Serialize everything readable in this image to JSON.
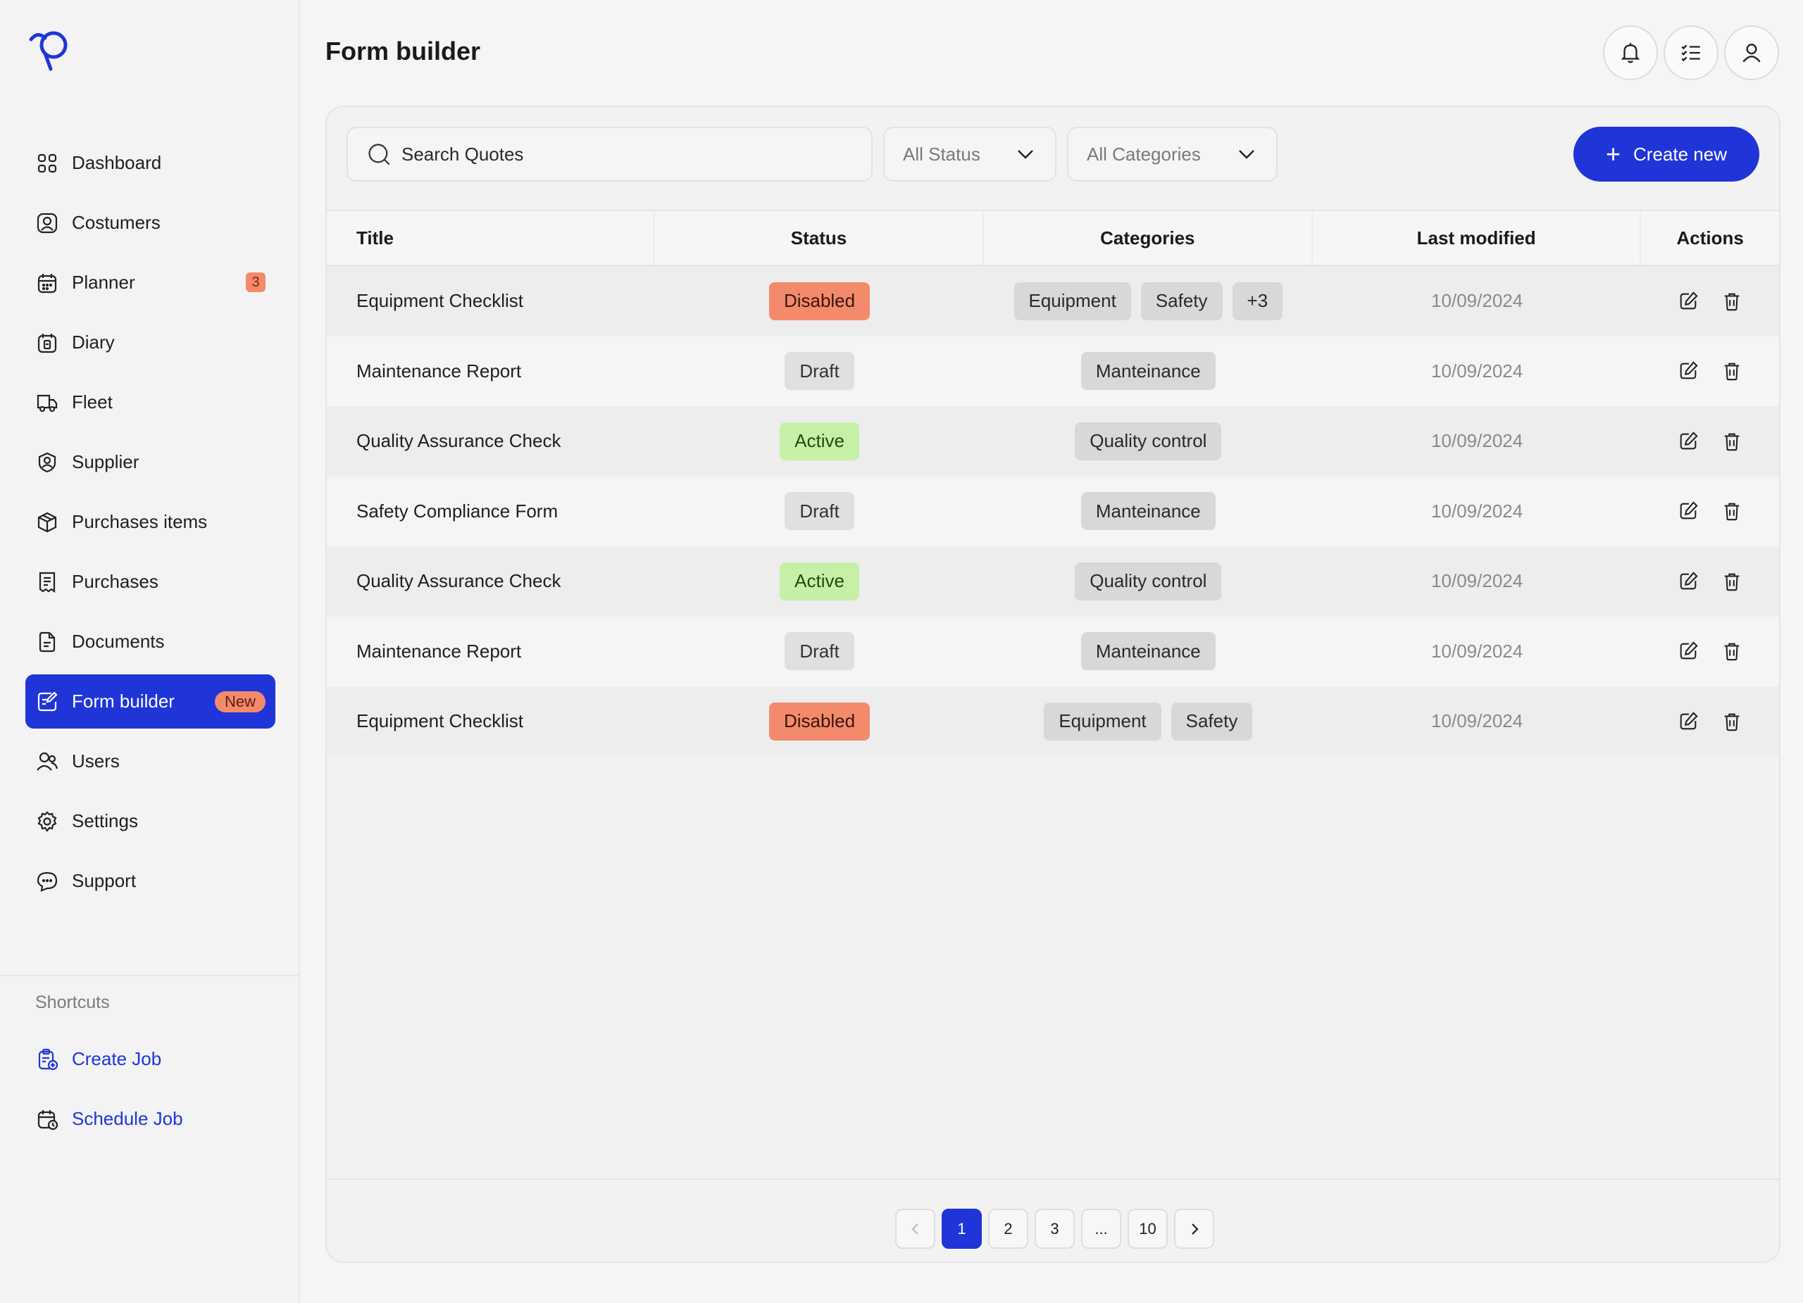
{
  "sidebar": {
    "items": [
      {
        "label": "Dashboard",
        "icon": "dashboard-grid-icon"
      },
      {
        "label": "Costumers",
        "icon": "user-square-icon"
      },
      {
        "label": "Planner",
        "icon": "calendar-icon",
        "badge": "3"
      },
      {
        "label": "Diary",
        "icon": "diary-icon"
      },
      {
        "label": "Fleet",
        "icon": "truck-icon"
      },
      {
        "label": "Supplier",
        "icon": "supplier-icon"
      },
      {
        "label": "Purchases items",
        "icon": "box-icon"
      },
      {
        "label": "Purchases",
        "icon": "receipt-icon"
      },
      {
        "label": "Documents",
        "icon": "document-icon"
      },
      {
        "label": "Form builder",
        "icon": "form-edit-icon",
        "badge": "New",
        "active": true
      },
      {
        "label": "Users",
        "icon": "users-icon"
      },
      {
        "label": "Settings",
        "icon": "gear-icon"
      },
      {
        "label": "Support",
        "icon": "chat-icon"
      }
    ],
    "shortcuts_title": "Shortcuts",
    "shortcuts": [
      {
        "label": "Create Job",
        "icon": "clipboard-add-icon"
      },
      {
        "label": "Schedule Job",
        "icon": "calendar-clock-icon"
      }
    ]
  },
  "header": {
    "title": "Form builder",
    "actions": [
      "bell-icon",
      "checklist-icon",
      "user-icon"
    ]
  },
  "toolbar": {
    "search_placeholder": "Search Quotes",
    "status_filter": "All Status",
    "category_filter": "All Categories",
    "create_label": "Create new"
  },
  "table": {
    "columns": [
      "Title",
      "Status",
      "Categories",
      "Last modified",
      "Actions"
    ],
    "rows": [
      {
        "title": "Equipment Checklist",
        "status": "Disabled",
        "categories": [
          "Equipment",
          "Safety",
          "+3"
        ],
        "modified": "10/09/2024"
      },
      {
        "title": "Maintenance Report",
        "status": "Draft",
        "categories": [
          "Manteinance"
        ],
        "modified": "10/09/2024"
      },
      {
        "title": "Quality Assurance Check",
        "status": "Active",
        "categories": [
          "Quality control"
        ],
        "modified": "10/09/2024"
      },
      {
        "title": "Safety Compliance Form",
        "status": "Draft",
        "categories": [
          "Manteinance"
        ],
        "modified": "10/09/2024"
      },
      {
        "title": "Quality Assurance Check",
        "status": "Active",
        "categories": [
          "Quality control"
        ],
        "modified": "10/09/2024"
      },
      {
        "title": "Maintenance Report",
        "status": "Draft",
        "categories": [
          "Manteinance"
        ],
        "modified": "10/09/2024"
      },
      {
        "title": "Equipment Checklist",
        "status": "Disabled",
        "categories": [
          "Equipment",
          "Safety"
        ],
        "modified": "10/09/2024"
      }
    ]
  },
  "pagination": {
    "pages": [
      "1",
      "2",
      "3",
      "...",
      "10"
    ],
    "current": "1"
  },
  "colors": {
    "accent": "#1f35d8",
    "disabled": "#f48a6c",
    "active": "#c6f0a8",
    "draft": "#e0e0e0"
  }
}
